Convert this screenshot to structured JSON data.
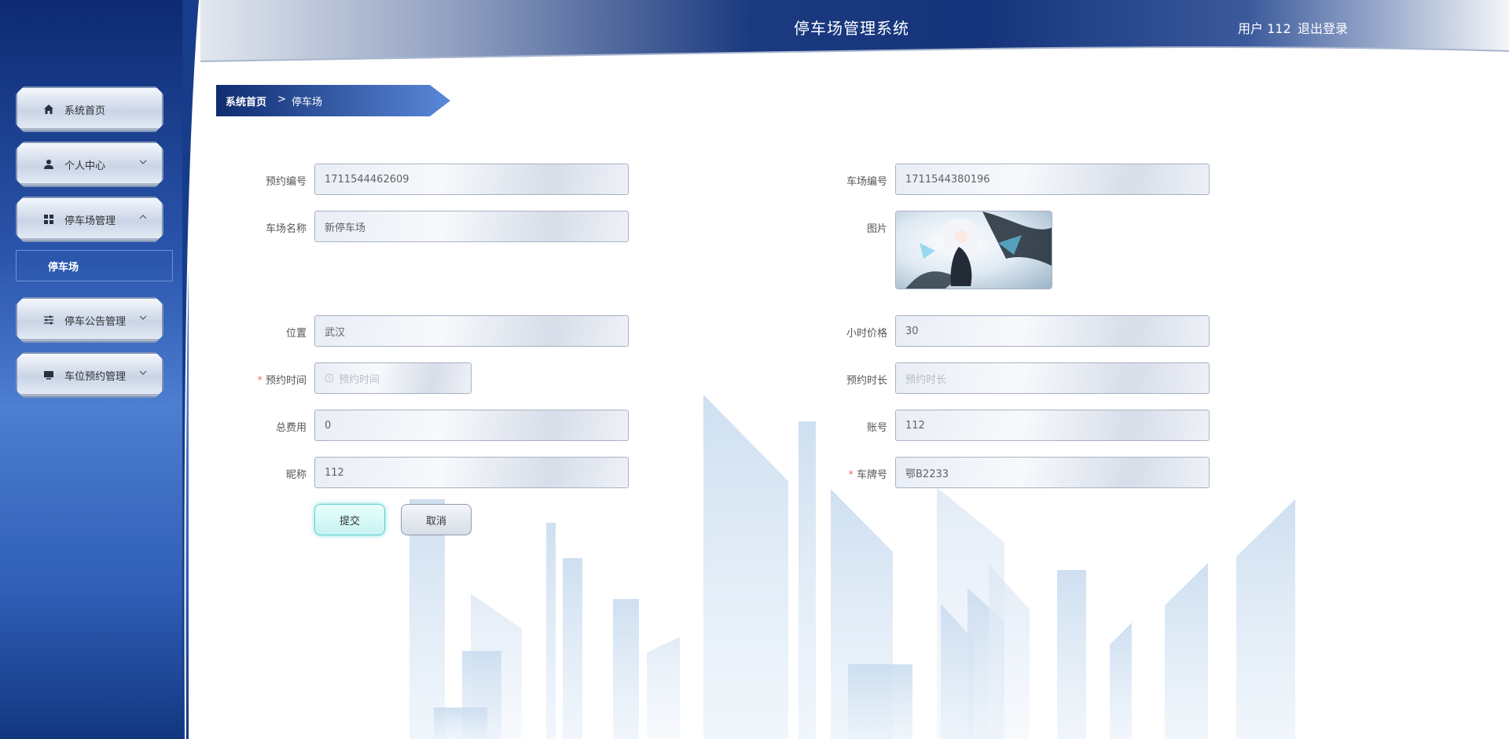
{
  "header": {
    "title": "停车场管理系统",
    "user_text": "用户 112",
    "logout_label": "退出登录"
  },
  "sidebar": {
    "items": [
      {
        "label": "系统首页",
        "icon": "home-icon"
      },
      {
        "label": "个人中心",
        "icon": "user-icon"
      },
      {
        "label": "停车场管理",
        "icon": "grid-icon"
      },
      {
        "label": "停车公告管理",
        "icon": "sliders-icon"
      },
      {
        "label": "车位预约管理",
        "icon": "monitor-icon"
      }
    ],
    "submenu": {
      "label": "停车场"
    }
  },
  "breadcrumb": {
    "home": "系统首页",
    "separator": ">",
    "current": "停车场"
  },
  "form": {
    "booking_no": {
      "label": "预约编号",
      "value": "1711544462609"
    },
    "lot_no": {
      "label": "车场编号",
      "value": "1711544380196"
    },
    "lot_name": {
      "label": "车场名称",
      "value": "新停车场"
    },
    "picture": {
      "label": "图片"
    },
    "location": {
      "label": "位置",
      "value": "武汉"
    },
    "hourly_price": {
      "label": "小时价格",
      "value": "30"
    },
    "booking_time": {
      "label": "预约时间",
      "placeholder": "预约时间",
      "required_mark": "*"
    },
    "booking_duration": {
      "label": "预约时长",
      "placeholder": "预约时长"
    },
    "total_fee": {
      "label": "总费用",
      "value": "0"
    },
    "account": {
      "label": "账号",
      "value": "112"
    },
    "nickname": {
      "label": "昵称",
      "value": "112"
    },
    "plate_no": {
      "label": "车牌号",
      "value": "鄂B2233",
      "required_mark": "*"
    },
    "submit_label": "提交",
    "cancel_label": "取消"
  },
  "colors": {
    "sidebar_dark": "#0d2a72",
    "sidebar_mid": "#4d7ed0",
    "header_blue": "#1e3f86",
    "accent_teal": "#5fd3cf",
    "required_red": "#f56c6c"
  }
}
